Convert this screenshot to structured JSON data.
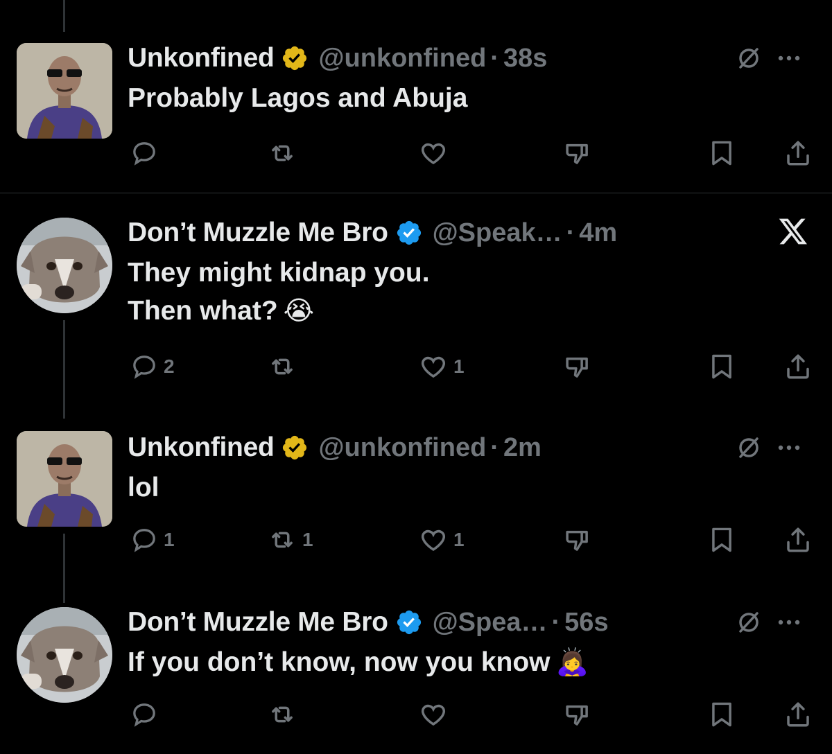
{
  "tweets": [
    {
      "name": "Unkonfined",
      "verified": "gold",
      "handle": "@unkonfined",
      "time": "38s",
      "lines": [
        "Probably Lagos and Abuja"
      ],
      "emoji": "",
      "top_icons": [
        "grok-slash-icon",
        "more-icon"
      ],
      "counts": {
        "reply": "",
        "repost": "",
        "like": ""
      }
    },
    {
      "name": "Don’t Muzzle Me Bro",
      "verified": "blue",
      "handle": "@Speak…",
      "time": "4m",
      "lines": [
        "They might kidnap you.",
        "Then what?"
      ],
      "emoji": "😭",
      "top_icons": [
        "x-logo-icon"
      ],
      "counts": {
        "reply": "2",
        "repost": "",
        "like": "1"
      }
    },
    {
      "name": "Unkonfined",
      "verified": "gold",
      "handle": "@unkonfined",
      "time": "2m",
      "lines": [
        "lol"
      ],
      "emoji": "",
      "top_icons": [
        "grok-slash-icon",
        "more-icon"
      ],
      "counts": {
        "reply": "1",
        "repost": "1",
        "like": "1"
      }
    },
    {
      "name": "Don’t Muzzle Me Bro",
      "verified": "blue",
      "handle": "@Spea…",
      "time": "56s",
      "lines": [
        "If you don’t know, now you know"
      ],
      "emoji": "🙇‍♀️",
      "top_icons": [
        "grok-slash-icon",
        "more-icon"
      ],
      "counts": {
        "reply": "",
        "repost": "",
        "like": ""
      }
    }
  ],
  "colors": {
    "background": "#000000",
    "text": "#e7e9ea",
    "muted": "#71767b",
    "gold_badge": "#e2b719",
    "blue_badge": "#1d9bf0",
    "line": "#2f3336"
  }
}
